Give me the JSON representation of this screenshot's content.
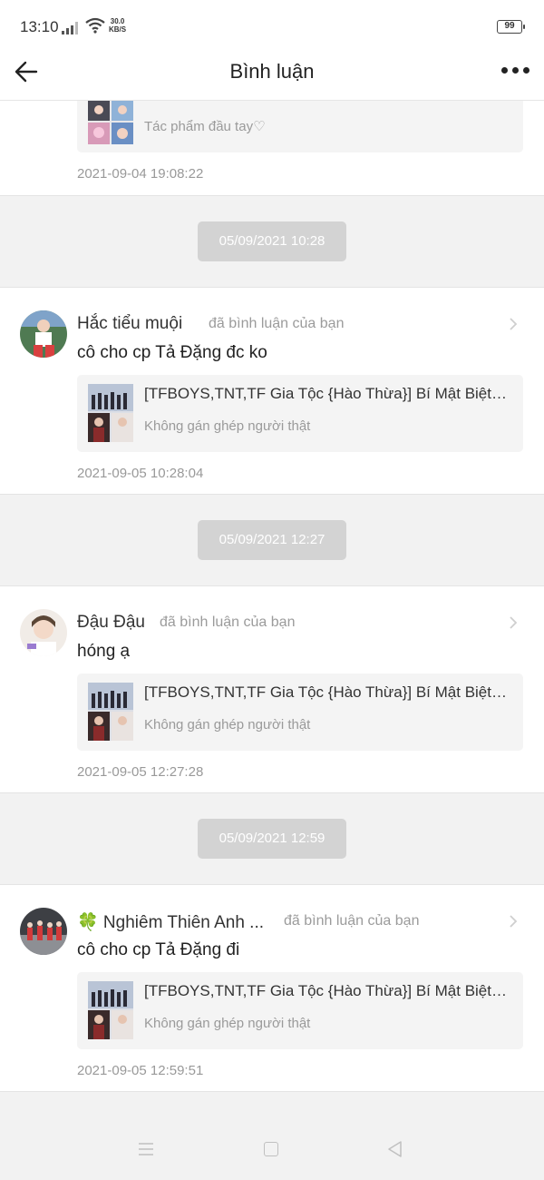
{
  "status_bar": {
    "time": "13:10",
    "net_speed_value": "30.0",
    "net_speed_unit": "KB/S",
    "battery": "99"
  },
  "header": {
    "title": "Bình luận"
  },
  "top_card": {
    "work_subtitle": "Tác phẩm đầu tay♡",
    "timestamp": "2021-09-04 19:08:22"
  },
  "groups": [
    {
      "date_divider": "05/09/2021 10:28",
      "user_name": "Hắc tiểu muội",
      "action": "đã bình luận của bạn",
      "comment": "cô cho cp Tả Đặng đc ko",
      "work_title": "[TFBOYS,TNT,TF Gia Tộc {Hào Thừa}] Bí Mật Biệt Thự",
      "work_subtitle": "Không gán ghép người thật",
      "timestamp": "2021-09-05 10:28:04"
    },
    {
      "date_divider": "05/09/2021 12:27",
      "user_name": "Đậu Đậu",
      "action": "đã bình luận của bạn",
      "comment": "hóng ạ",
      "work_title": "[TFBOYS,TNT,TF Gia Tộc {Hào Thừa}] Bí Mật Biệt Thự",
      "work_subtitle": "Không gán ghép người thật",
      "timestamp": "2021-09-05 12:27:28"
    },
    {
      "date_divider": "05/09/2021 12:59",
      "user_name": "🍀 Nghiêm Thiên Anh ...",
      "action": "đã bình luận của bạn",
      "comment": "cô cho cp Tả Đặng đi",
      "work_title": "[TFBOYS,TNT,TF Gia Tộc {Hào Thừa}] Bí Mật Biệt Thự",
      "work_subtitle": "Không gán ghép người thật",
      "timestamp": "2021-09-05 12:59:51"
    }
  ],
  "colors": {
    "pill": "#d3d3d3",
    "muted_text": "#999999",
    "card": "#ffffff",
    "page": "#f2f2f2"
  },
  "icons": [
    "back-arrow-icon",
    "more-icon",
    "chevron-right-icon",
    "signal-icon",
    "wifi-icon",
    "battery-icon",
    "menu-icon",
    "home-icon",
    "back-triangle-icon"
  ]
}
